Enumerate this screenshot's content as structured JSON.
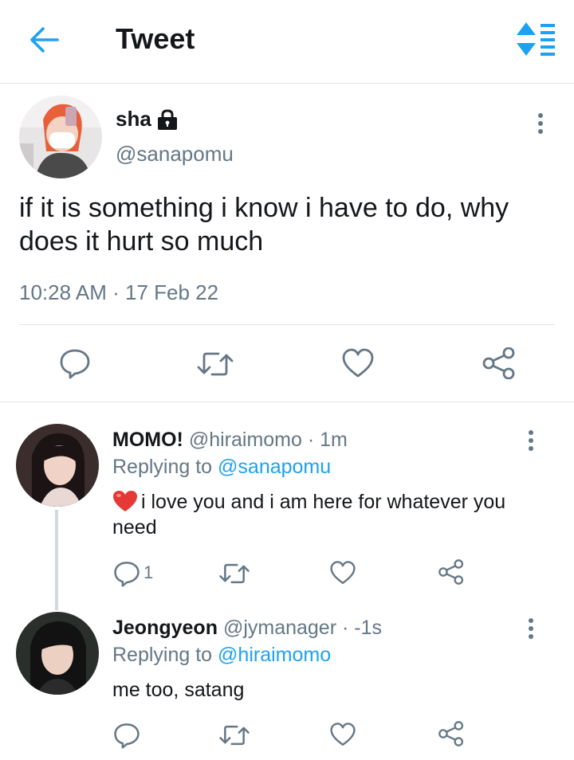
{
  "header": {
    "title": "Tweet",
    "back_icon": "arrow-left-icon",
    "sort_icon": "sort-icon",
    "accent": "#1da1f2"
  },
  "main_tweet": {
    "name": "sha",
    "handle": "@sanapomu",
    "text": "if it is something i know i have to do, why does it hurt so much",
    "time": "10:28 AM",
    "separator": "·",
    "date": "17 Feb 22"
  },
  "replies": [
    {
      "name": "MOMO!",
      "handle": "@hiraimomo",
      "time_sep": "·",
      "time": "1m",
      "replying_label": "Replying to",
      "replying_to": "@sanapomu",
      "emoji": "❤️",
      "text": "i love you and i am here for whatever you need",
      "reply_count": "1"
    },
    {
      "name": "Jeongyeon",
      "handle": "@jymanager",
      "time_sep": "·",
      "time": "-1s",
      "replying_label": "Replying to",
      "replying_to": "@hiraimomo",
      "text": "me too, satang"
    }
  ]
}
